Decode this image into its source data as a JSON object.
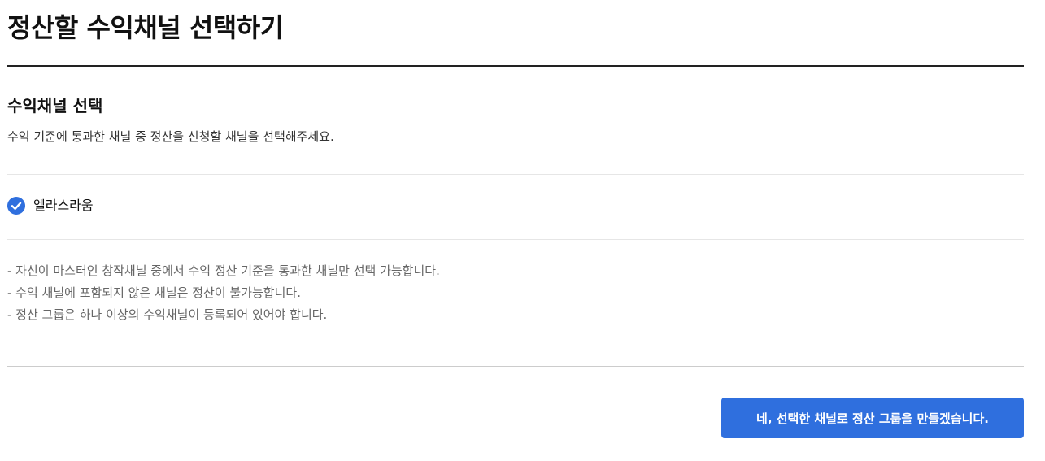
{
  "page": {
    "title": "정산할 수익채널 선택하기"
  },
  "section": {
    "heading": "수익채널 선택",
    "description": "수익 기준에 통과한 채널 중 정산을 신청할 채널을 선택해주세요."
  },
  "channels": [
    {
      "label": "엘라스라움",
      "checked": true,
      "icon": "check-circle-icon"
    }
  ],
  "notes": [
    "- 자신이 마스터인 창작채널 중에서 수익 정산 기준을 통과한 채널만 선택 가능합니다.",
    "- 수익 채널에 포함되지 않은 채널은 정산이 불가능합니다.",
    "- 정산 그룹은 하나 이상의 수익채널이 등록되어 있어야 합니다."
  ],
  "actions": {
    "confirm_label": "네, 선택한 채널로 정산 그룹을 만들겠습니다."
  },
  "colors": {
    "accent": "#2f6fde",
    "text": "#111111",
    "muted": "#666666"
  }
}
